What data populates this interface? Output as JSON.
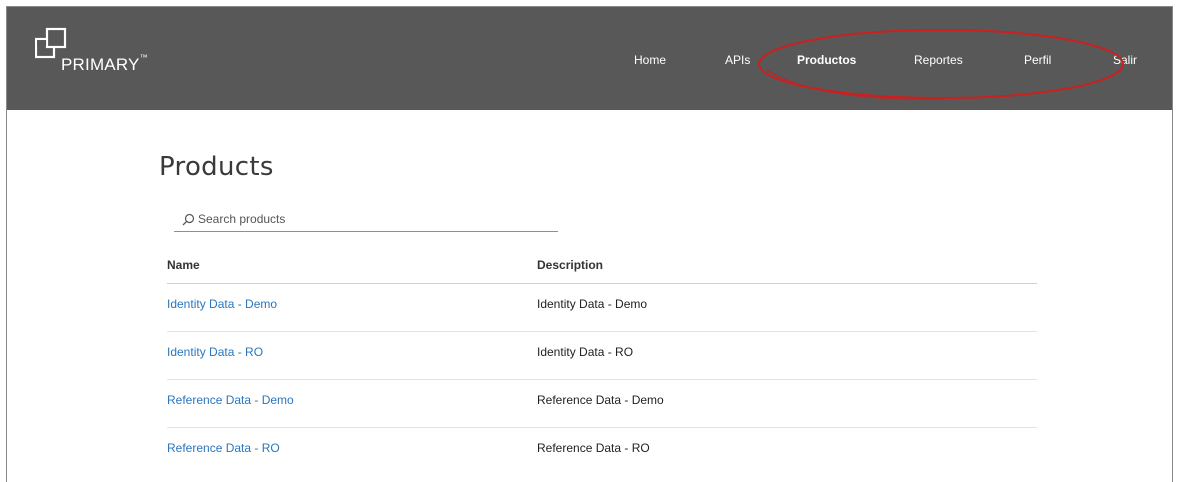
{
  "header": {
    "brand": "PRIMARY",
    "brand_mark": "™",
    "nav": [
      {
        "label": "Home"
      },
      {
        "label": "APIs"
      },
      {
        "label": "Productos"
      },
      {
        "label": "Reportes"
      },
      {
        "label": "Perfil"
      },
      {
        "label": "Salir"
      }
    ],
    "active_nav": "Productos",
    "colors": {
      "header_bg": "#585858",
      "annotation": "#cc1f1f"
    }
  },
  "main": {
    "title": "Products",
    "search": {
      "placeholder": "Search products",
      "value": ""
    },
    "table": {
      "columns": [
        "Name",
        "Description"
      ],
      "rows": [
        {
          "name": "Identity Data - Demo",
          "description": "Identity Data - Demo"
        },
        {
          "name": "Identity Data - RO",
          "description": "Identity Data - RO"
        },
        {
          "name": "Reference Data - Demo",
          "description": "Reference Data - Demo"
        },
        {
          "name": "Reference Data - RO",
          "description": "Reference Data - RO"
        }
      ]
    },
    "colors": {
      "link": "#2a76bf"
    }
  }
}
